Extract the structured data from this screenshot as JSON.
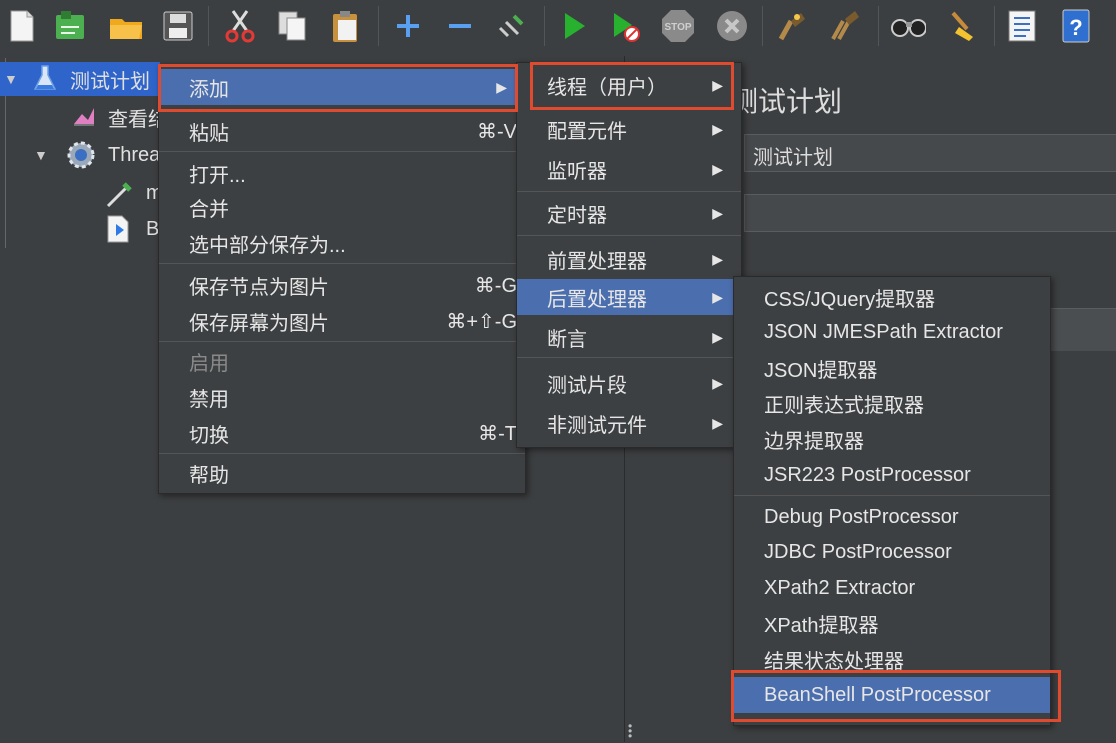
{
  "tree": {
    "items": [
      {
        "label": "测试计划",
        "icon": "test-plan-flask-icon"
      },
      {
        "label": "查看结果树",
        "icon": "result-tree-icon"
      },
      {
        "label": "Thread Group",
        "icon": "thread-group-gear-icon"
      },
      {
        "label": "m",
        "icon": "pipette-sampler-icon"
      },
      {
        "label": "B",
        "icon": "beanshell-doc-icon"
      }
    ]
  },
  "right_panel": {
    "title": "测试计划",
    "name_value": "测试计划",
    "comment_value": ""
  },
  "context_menu": {
    "add": "添加",
    "paste": "粘贴",
    "paste_shortcut": "⌘-V",
    "open": "打开...",
    "merge": "合并",
    "save_selection": "选中部分保存为...",
    "save_node_image": "保存节点为图片",
    "save_node_image_shortcut": "⌘-G",
    "save_screen_image": "保存屏幕为图片",
    "save_screen_image_shortcut": "⌘+⇧-G",
    "enable": "启用",
    "disable": "禁用",
    "toggle": "切换",
    "toggle_shortcut": "⌘-T",
    "help": "帮助"
  },
  "add_menu": {
    "threads": "线程（用户）",
    "config": "配置元件",
    "listener": "监听器",
    "timer": "定时器",
    "pre_processor": "前置处理器",
    "post_processor": "后置处理器",
    "assertion": "断言",
    "test_fragment": "测试片段",
    "non_test": "非测试元件"
  },
  "post_processor_menu": {
    "items": [
      "CSS/JQuery提取器",
      "JSON JMESPath Extractor",
      "JSON提取器",
      "正则表达式提取器",
      "边界提取器",
      "JSR223 PostProcessor",
      "Debug PostProcessor",
      "JDBC PostProcessor",
      "XPath2 Extractor",
      "XPath提取器",
      "结果状态处理器",
      "BeanShell PostProcessor"
    ]
  },
  "colors": {
    "background": "#3c3f41",
    "menu_highlight": "#4b6eaf",
    "tree_selection": "#2f65ca",
    "annotation_red": "#e04a2f"
  },
  "toolbar_icons": [
    "new-icon",
    "templates-icon",
    "open-icon",
    "save-icon",
    "cut-icon",
    "copy-icon",
    "paste-icon",
    "expand-icon",
    "collapse-icon",
    "toggle-icon",
    "start-icon",
    "start-no-pause-icon",
    "stop-icon",
    "shutdown-icon",
    "clear-icon",
    "clear-all-icon",
    "search-icon",
    "reset-search-icon",
    "function-helper-icon",
    "help-icon"
  ]
}
